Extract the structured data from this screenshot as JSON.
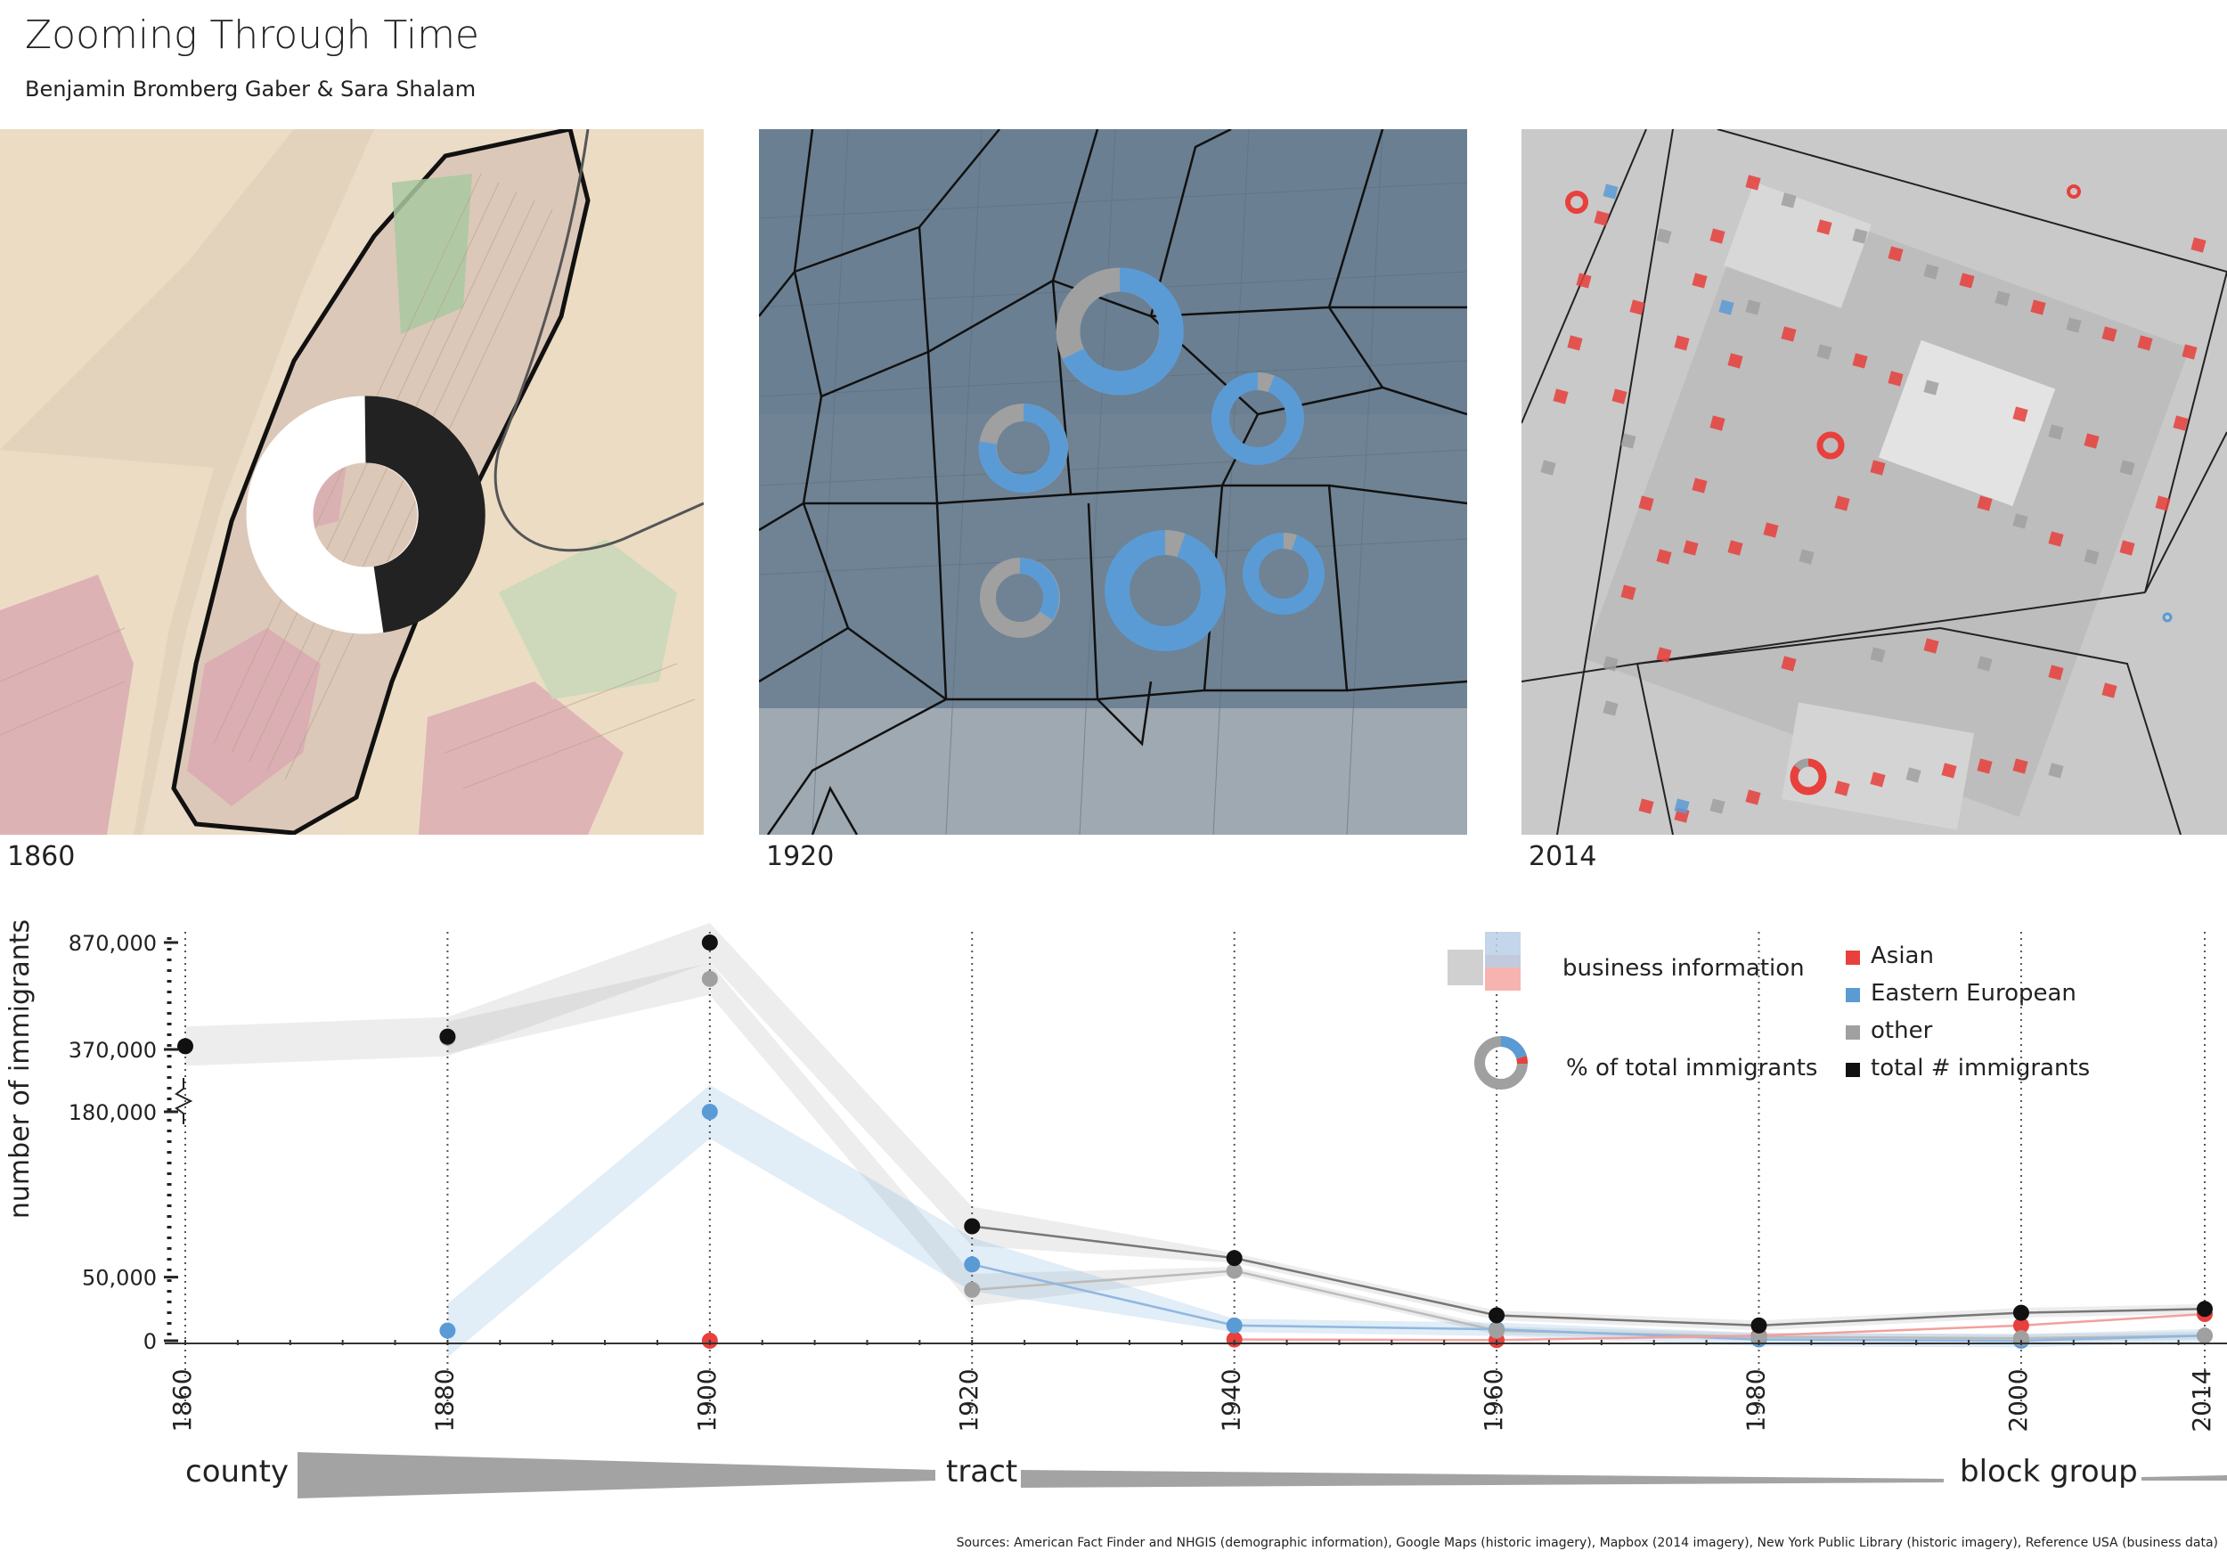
{
  "header": {
    "title": "Zooming Through Time",
    "authors": "Benjamin Bromberg Gaber & Sara Shalam"
  },
  "panels": [
    {
      "year": "1860"
    },
    {
      "year": "1920"
    },
    {
      "year": "2014"
    }
  ],
  "legend": {
    "business": "business information",
    "percent": "% of total immigrants",
    "asian": "Asian",
    "eastern": "Eastern European",
    "other": "other",
    "total": "total # immigrants"
  },
  "scale": {
    "county": "county",
    "tract": "tract",
    "block_group": "block group"
  },
  "sources": "Sources: American Fact Finder and NHGIS (demographic information), Google Maps (historic imagery), Mapbox (2014 imagery), New York Public Library (historic imagery), Reference USA (business data)",
  "colors": {
    "asian": "#e8403c",
    "eastern": "#5b9bd5",
    "other": "#a0a0a0",
    "total": "#111111"
  },
  "chart_data": {
    "type": "line",
    "ylabel": "number of immigrants",
    "y_ticks": [
      "870,000",
      "370,000",
      "180,000",
      "50,000",
      "0"
    ],
    "axis_break": true,
    "x": [
      1860,
      1880,
      1900,
      1920,
      1940,
      1960,
      1980,
      2000,
      2014
    ],
    "x_ticks": [
      "1860",
      "1880",
      "1900",
      "1920",
      "1940",
      "1960",
      "1980",
      "2000",
      "2014"
    ],
    "series": [
      {
        "name": "total # immigrants",
        "color": "#111111",
        "values": [
          385000,
          430000,
          870000,
          90000,
          65000,
          20000,
          12000,
          22000,
          25000
        ]
      },
      {
        "name": "other",
        "color": "#a0a0a0",
        "values": [
          null,
          425000,
          700000,
          40000,
          55000,
          8000,
          3000,
          2000,
          4000
        ]
      },
      {
        "name": "Eastern European",
        "color": "#5b9bd5",
        "values": [
          null,
          8000,
          180000,
          60000,
          12000,
          9000,
          1000,
          0,
          4000
        ]
      },
      {
        "name": "Asian",
        "color": "#e8403c",
        "values": [
          null,
          null,
          0,
          null,
          1000,
          500,
          4000,
          12000,
          21000
        ]
      }
    ]
  }
}
